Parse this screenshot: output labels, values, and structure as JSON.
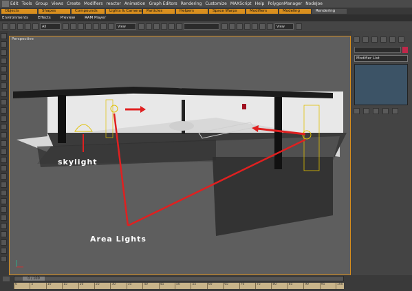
{
  "menubar": {
    "items": [
      "Edit",
      "Tools",
      "Group",
      "Views",
      "Create",
      "Modifiers",
      "reactor",
      "Animation",
      "Graph Editors",
      "Rendering",
      "Customize",
      "MAXScript",
      "Help",
      "PolygonManager",
      "NodeJoe"
    ]
  },
  "tabbar": {
    "tabs": [
      "Objects",
      "Shapes",
      "Compounds",
      "Lights & Cameras",
      "Particles",
      "Helpers",
      "Space Warps",
      "Modifiers",
      "Modeling",
      "Rendering"
    ]
  },
  "subbar": {
    "items": [
      "Environments",
      "Effects",
      "Preview",
      "RAM Player"
    ]
  },
  "toolbar": {
    "selection_filter": "All",
    "ref_coord": "View",
    "view_dropdown": "View"
  },
  "viewport": {
    "label": "Perspective"
  },
  "annotations": {
    "skylight": "skylight",
    "area_lights": "Area Lights",
    "arrow_color": "#e02020"
  },
  "command_panel": {
    "modifier_list": "Modifier List"
  },
  "timeline": {
    "frame_display": "0 / 100",
    "ticks": [
      "0",
      "5",
      "10",
      "15",
      "20",
      "25",
      "30",
      "35",
      "40",
      "45",
      "50",
      "55",
      "60",
      "65",
      "70",
      "75",
      "80",
      "85",
      "90",
      "95",
      "100"
    ]
  },
  "colors": {
    "accent": "#d98f1e",
    "stack_panel": "#3c5366"
  }
}
